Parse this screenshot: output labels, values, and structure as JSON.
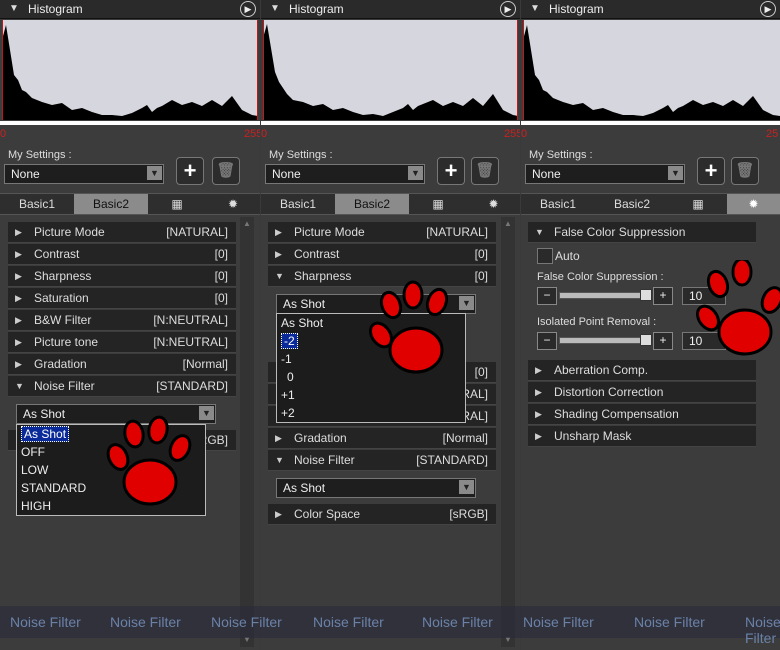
{
  "panels": [
    {
      "histogram": {
        "title": "Histogram",
        "low": "0",
        "high": "255"
      },
      "settings": {
        "label": "My Settings :",
        "value": "None"
      },
      "tabs": [
        "Basic1",
        "Basic2"
      ],
      "rows": [
        {
          "label": "Picture Mode",
          "value": "[NATURAL]"
        },
        {
          "label": "Contrast",
          "value": "[0]"
        },
        {
          "label": "Sharpness",
          "value": "[0]"
        },
        {
          "label": "Saturation",
          "value": "[0]"
        },
        {
          "label": "B&W Filter",
          "value": "[N:NEUTRAL]"
        },
        {
          "label": "Picture tone",
          "value": "[N:NEUTRAL]"
        },
        {
          "label": "Gradation",
          "value": "[Normal]"
        },
        {
          "label": "Noise Filter",
          "value": "[STANDARD]"
        }
      ],
      "noise_combo": "As Shot",
      "noise_options": [
        "As Shot",
        "OFF",
        "LOW",
        "STANDARD",
        "HIGH"
      ],
      "partial_value": "RGB]"
    },
    {
      "histogram": {
        "title": "Histogram",
        "low": "0",
        "high": "255"
      },
      "settings": {
        "label": "My Settings :",
        "value": "None"
      },
      "tabs": [
        "Basic1",
        "Basic2"
      ],
      "rows_top": [
        {
          "label": "Picture Mode",
          "value": "[NATURAL]"
        },
        {
          "label": "Contrast",
          "value": "[0]"
        },
        {
          "label": "Sharpness",
          "value": "[0]"
        }
      ],
      "sharp_combo": "As Shot",
      "sharp_options": [
        "As Shot",
        "-2",
        "-1",
        "0",
        "+1",
        "+2"
      ],
      "partial_values": [
        "[0]",
        "RAL]",
        "RAL]"
      ],
      "rows_bottom": [
        {
          "label": "Gradation",
          "value": "[Normal]"
        },
        {
          "label": "Noise Filter",
          "value": "[STANDARD]"
        }
      ],
      "noise_combo": "As Shot",
      "color_space": {
        "label": "Color Space",
        "value": "[sRGB]"
      }
    },
    {
      "histogram": {
        "title": "Histogram",
        "low": "0",
        "high": "25"
      },
      "settings": {
        "label": "My Settings :",
        "value": "None"
      },
      "tabs": [
        "Basic1",
        "Basic2"
      ],
      "fcs_header": "False Color Suppression",
      "auto_label": "Auto",
      "fcs_label": "False Color Suppression :",
      "fcs_value": "10",
      "ipr_label": "Isolated Point Removal :",
      "ipr_value": "10",
      "rows": [
        {
          "label": "Aberration Comp."
        },
        {
          "label": "Distortion Correction"
        },
        {
          "label": "Shading Compensation"
        },
        {
          "label": "Unsharp Mask"
        }
      ]
    }
  ],
  "watermark": [
    "Noise Filter",
    "Noise Filter",
    "Noise Filter",
    "Noise Filter",
    "Noise Filter",
    "Noise Filter",
    "Noise Filter",
    "Noise Filter",
    "Noise"
  ],
  "colors": {
    "accent_red": "#e00000",
    "selection_blue": "#0a2a9a"
  }
}
